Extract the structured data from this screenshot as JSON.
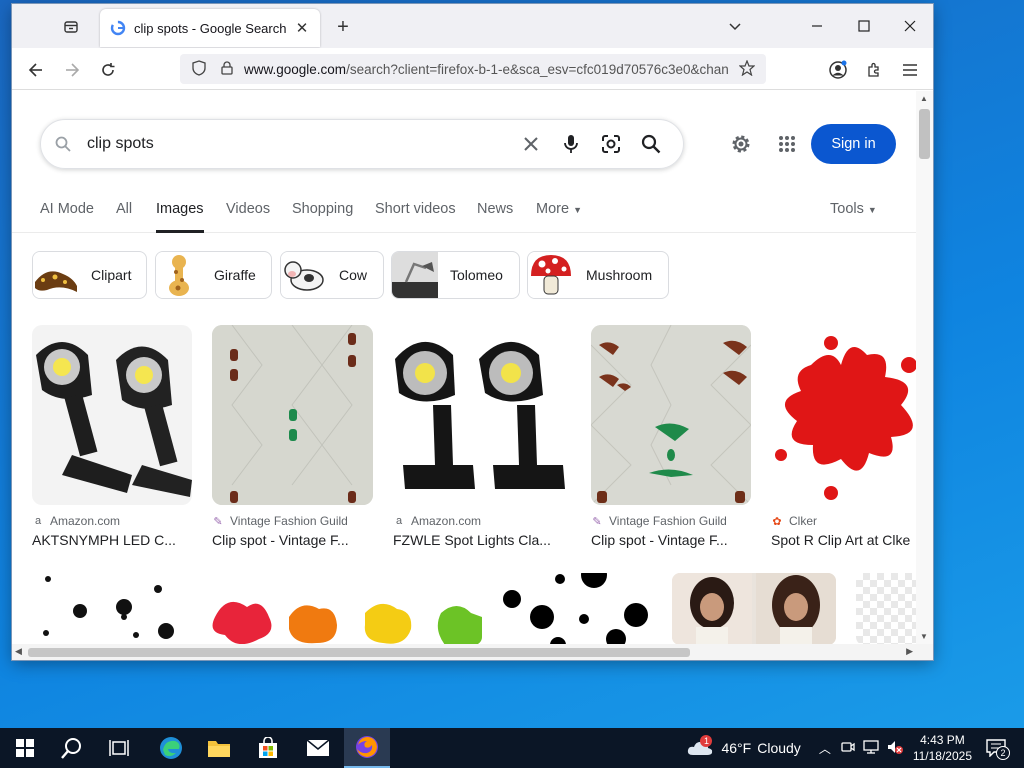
{
  "browser": {
    "tab_title": "clip spots - Google Search",
    "url_host": "www.google.com",
    "url_path": "/search?client=firefox-b-1-e&sca_esv=cfc019d70576c3e0&chan"
  },
  "search": {
    "query": "clip spots",
    "signin_label": "Sign in"
  },
  "gtabs": [
    {
      "label": "AI Mode"
    },
    {
      "label": "All"
    },
    {
      "label": "Images"
    },
    {
      "label": "Videos"
    },
    {
      "label": "Shopping"
    },
    {
      "label": "Short videos"
    },
    {
      "label": "News"
    },
    {
      "label": "More"
    },
    {
      "label": "Tools"
    }
  ],
  "chips": [
    {
      "label": "Clipart"
    },
    {
      "label": "Giraffe"
    },
    {
      "label": "Cow"
    },
    {
      "label": "Tolomeo"
    },
    {
      "label": "Mushroom"
    }
  ],
  "results": [
    {
      "source": "Amazon.com",
      "caption": "AKTSNYMPH LED C..."
    },
    {
      "source": "Vintage Fashion Guild",
      "caption": "Clip spot - Vintage F..."
    },
    {
      "source": "Amazon.com",
      "caption": "FZWLE Spot Lights Cla..."
    },
    {
      "source": "Vintage Fashion Guild",
      "caption": "Clip spot - Vintage F..."
    },
    {
      "source": "Clker",
      "caption": "Spot R Clip Art at Clke"
    }
  ],
  "taskbar": {
    "weather_temp": "46°F",
    "weather_desc": "Cloudy",
    "weather_badge": "1",
    "time": "4:43 PM",
    "date": "11/18/2025",
    "notif_count": "2"
  },
  "colors": {
    "accent": "#0b57d0",
    "taskbar": "#0b1626",
    "desktop": "#1273d1"
  }
}
